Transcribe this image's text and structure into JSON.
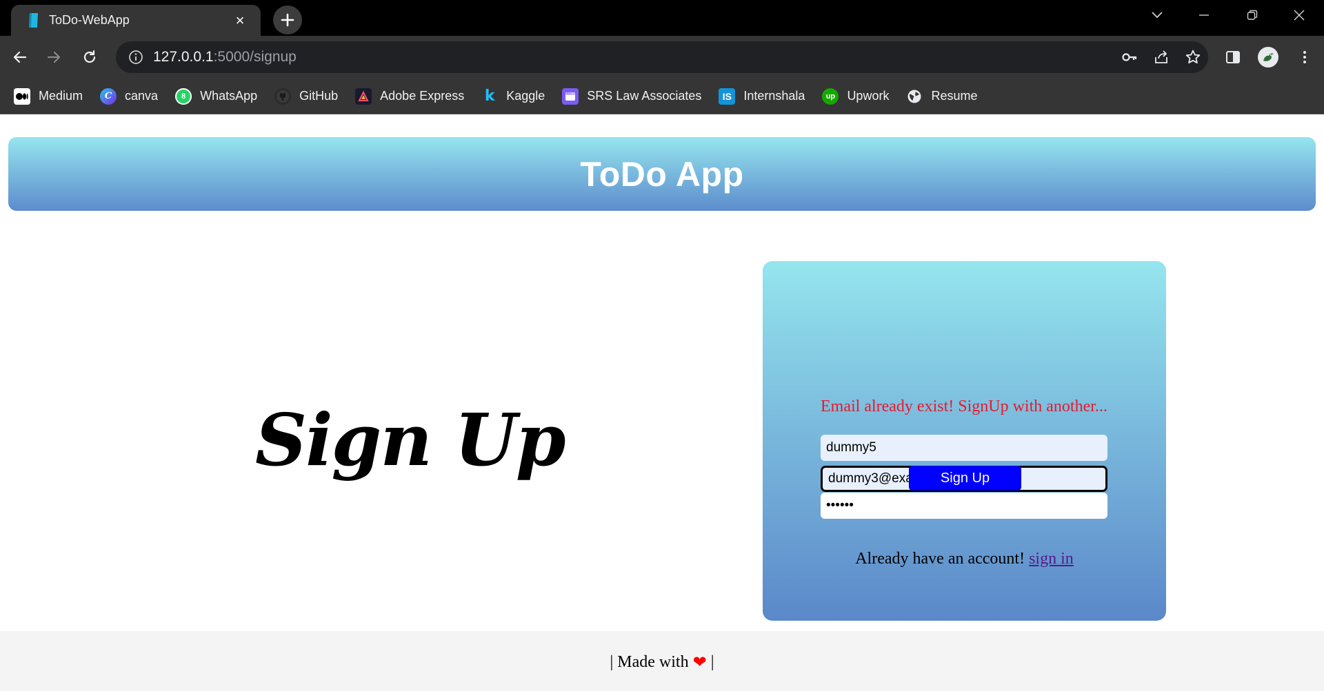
{
  "browser": {
    "tab": {
      "title": "ToDo-WebApp",
      "close": "×"
    },
    "new_tab": "+",
    "url": {
      "host": "127.0.0.1",
      "path": ":5000/signup"
    },
    "bookmarks": [
      {
        "label": "Medium",
        "icon": "medium-icon",
        "color": "#ffffff"
      },
      {
        "label": "canva",
        "icon": "canva-icon",
        "color": "#4b6bff"
      },
      {
        "label": "WhatsApp",
        "icon": "whatsapp-icon",
        "color": "#25d366"
      },
      {
        "label": "GitHub",
        "icon": "github-icon",
        "color": "#1b1f23"
      },
      {
        "label": "Adobe Express",
        "icon": "adobe-express-icon",
        "color": "#1a1a2e"
      },
      {
        "label": "Kaggle",
        "icon": "kaggle-icon",
        "color": "#20beff"
      },
      {
        "label": "SRS Law Associates",
        "icon": "srs-law-icon",
        "color": "#7a5cf0"
      },
      {
        "label": "Internshala",
        "icon": "internshala-icon",
        "color": "#1295d8"
      },
      {
        "label": "Upwork",
        "icon": "upwork-icon",
        "color": "#14a800"
      },
      {
        "label": "Resume",
        "icon": "globe-icon",
        "color": "#e8eaed"
      }
    ]
  },
  "app": {
    "title": "ToDo App",
    "heading": "Sign Up",
    "form": {
      "username": "dummy5",
      "email": "dummy3@example.com",
      "error": "Email already exist! SignUp with another...",
      "password": "••••••",
      "submit": "Sign Up",
      "have_account": "Already have an account! ",
      "signin_link": "sign in"
    },
    "footer": {
      "prefix": "| Made with",
      "suffix": "|"
    }
  },
  "colors": {
    "header_gradient_top": "#95e5ee",
    "header_gradient_bottom": "#5d8ccd",
    "button": "#0000ff",
    "error": "#e8192c",
    "heart": "#ff0000"
  }
}
